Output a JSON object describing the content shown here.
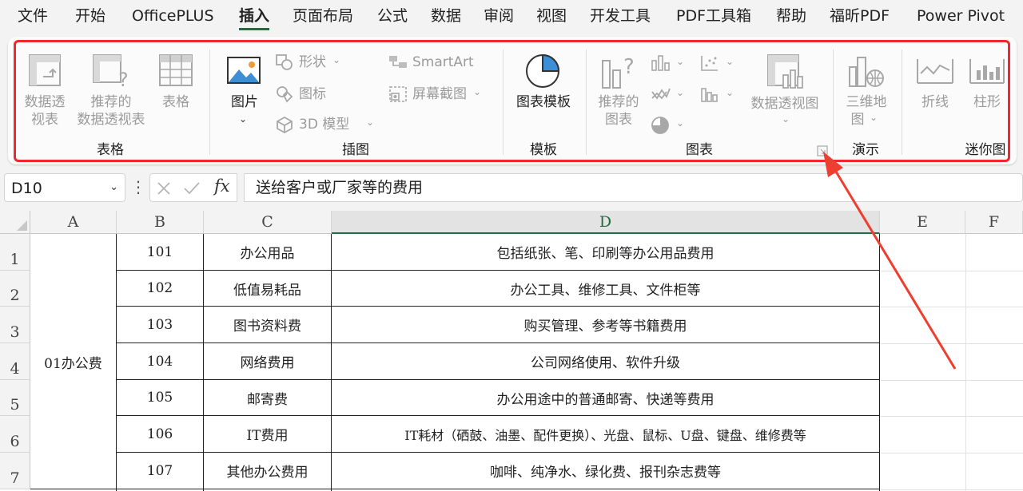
{
  "menu": {
    "tabs": [
      "文件",
      "开始",
      "OfficePLUS",
      "插入",
      "页面布局",
      "公式",
      "数据",
      "审阅",
      "视图",
      "开发工具",
      "PDF工具箱",
      "帮助",
      "福昕PDF",
      "Power Pivot"
    ],
    "active": "插入"
  },
  "ribbon": {
    "table_group": {
      "label": "表格",
      "pivot_line1": "数据透",
      "pivot_line2": "视表",
      "rec_pivot_line1": "推荐的",
      "rec_pivot_line2": "数据透视表",
      "table": "表格"
    },
    "illustrations_group": {
      "label": "插图",
      "picture": "图片",
      "shapes": "形状",
      "icons": "图标",
      "model3d": "3D 模型",
      "smartart": "SmartArt",
      "screenshot": "屏幕截图"
    },
    "template_group": {
      "label": "模板",
      "chart_template": "图表模板"
    },
    "charts_group": {
      "label": "图表",
      "rec_charts_line1": "推荐的",
      "rec_charts_line2": "图表",
      "pivot_chart": "数据透视图"
    },
    "demo_group": {
      "label": "演示",
      "map3d_line1": "三维地",
      "map3d_line2": "图"
    },
    "sparkline_group": {
      "label": "迷你图",
      "line": "折线",
      "column": "柱形"
    }
  },
  "formula_bar": {
    "name_box": "D10",
    "fx": "fx",
    "content": "送给客户或厂家等的费用"
  },
  "sheet": {
    "columns": [
      "A",
      "B",
      "C",
      "D",
      "E",
      "F"
    ],
    "row_numbers": [
      "1",
      "2",
      "3",
      "4",
      "5",
      "6",
      "7"
    ],
    "category": "01办公费",
    "rows": [
      {
        "code": "101",
        "name": "办公用品",
        "desc": "包括纸张、笔、印刷等办公用品费用"
      },
      {
        "code": "102",
        "name": "低值易耗品",
        "desc": "办公工具、维修工具、文件柜等"
      },
      {
        "code": "103",
        "name": "图书资料费",
        "desc": "购买管理、参考等书籍费用"
      },
      {
        "code": "104",
        "name": "网络费用",
        "desc": "公司网络使用、软件升级"
      },
      {
        "code": "105",
        "name": "邮寄费",
        "desc": "办公用途中的普通邮寄、快递等费用"
      },
      {
        "code": "106",
        "name": "IT费用",
        "desc": "IT耗材（硒鼓、油墨、配件更换）、光盘、鼠标、U盘、键盘、维修费等"
      },
      {
        "code": "107",
        "name": "其他办公费用",
        "desc": "咖啡、纯净水、绿化费、报刊杂志费等"
      }
    ]
  },
  "colors": {
    "highlight": "#f0282d",
    "active_tab_underline": "#1e6e42",
    "arrow": "#ee3e2f"
  }
}
